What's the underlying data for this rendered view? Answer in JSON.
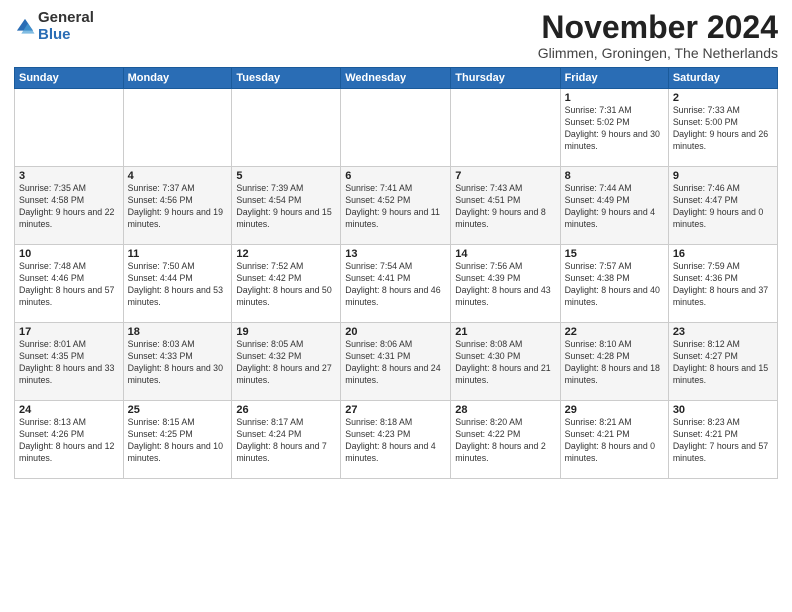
{
  "logo": {
    "general": "General",
    "blue": "Blue"
  },
  "header": {
    "title": "November 2024",
    "location": "Glimmen, Groningen, The Netherlands"
  },
  "weekdays": [
    "Sunday",
    "Monday",
    "Tuesday",
    "Wednesday",
    "Thursday",
    "Friday",
    "Saturday"
  ],
  "weeks": [
    [
      {
        "day": "",
        "info": ""
      },
      {
        "day": "",
        "info": ""
      },
      {
        "day": "",
        "info": ""
      },
      {
        "day": "",
        "info": ""
      },
      {
        "day": "",
        "info": ""
      },
      {
        "day": "1",
        "info": "Sunrise: 7:31 AM\nSunset: 5:02 PM\nDaylight: 9 hours and 30 minutes."
      },
      {
        "day": "2",
        "info": "Sunrise: 7:33 AM\nSunset: 5:00 PM\nDaylight: 9 hours and 26 minutes."
      }
    ],
    [
      {
        "day": "3",
        "info": "Sunrise: 7:35 AM\nSunset: 4:58 PM\nDaylight: 9 hours and 22 minutes."
      },
      {
        "day": "4",
        "info": "Sunrise: 7:37 AM\nSunset: 4:56 PM\nDaylight: 9 hours and 19 minutes."
      },
      {
        "day": "5",
        "info": "Sunrise: 7:39 AM\nSunset: 4:54 PM\nDaylight: 9 hours and 15 minutes."
      },
      {
        "day": "6",
        "info": "Sunrise: 7:41 AM\nSunset: 4:52 PM\nDaylight: 9 hours and 11 minutes."
      },
      {
        "day": "7",
        "info": "Sunrise: 7:43 AM\nSunset: 4:51 PM\nDaylight: 9 hours and 8 minutes."
      },
      {
        "day": "8",
        "info": "Sunrise: 7:44 AM\nSunset: 4:49 PM\nDaylight: 9 hours and 4 minutes."
      },
      {
        "day": "9",
        "info": "Sunrise: 7:46 AM\nSunset: 4:47 PM\nDaylight: 9 hours and 0 minutes."
      }
    ],
    [
      {
        "day": "10",
        "info": "Sunrise: 7:48 AM\nSunset: 4:46 PM\nDaylight: 8 hours and 57 minutes."
      },
      {
        "day": "11",
        "info": "Sunrise: 7:50 AM\nSunset: 4:44 PM\nDaylight: 8 hours and 53 minutes."
      },
      {
        "day": "12",
        "info": "Sunrise: 7:52 AM\nSunset: 4:42 PM\nDaylight: 8 hours and 50 minutes."
      },
      {
        "day": "13",
        "info": "Sunrise: 7:54 AM\nSunset: 4:41 PM\nDaylight: 8 hours and 46 minutes."
      },
      {
        "day": "14",
        "info": "Sunrise: 7:56 AM\nSunset: 4:39 PM\nDaylight: 8 hours and 43 minutes."
      },
      {
        "day": "15",
        "info": "Sunrise: 7:57 AM\nSunset: 4:38 PM\nDaylight: 8 hours and 40 minutes."
      },
      {
        "day": "16",
        "info": "Sunrise: 7:59 AM\nSunset: 4:36 PM\nDaylight: 8 hours and 37 minutes."
      }
    ],
    [
      {
        "day": "17",
        "info": "Sunrise: 8:01 AM\nSunset: 4:35 PM\nDaylight: 8 hours and 33 minutes."
      },
      {
        "day": "18",
        "info": "Sunrise: 8:03 AM\nSunset: 4:33 PM\nDaylight: 8 hours and 30 minutes."
      },
      {
        "day": "19",
        "info": "Sunrise: 8:05 AM\nSunset: 4:32 PM\nDaylight: 8 hours and 27 minutes."
      },
      {
        "day": "20",
        "info": "Sunrise: 8:06 AM\nSunset: 4:31 PM\nDaylight: 8 hours and 24 minutes."
      },
      {
        "day": "21",
        "info": "Sunrise: 8:08 AM\nSunset: 4:30 PM\nDaylight: 8 hours and 21 minutes."
      },
      {
        "day": "22",
        "info": "Sunrise: 8:10 AM\nSunset: 4:28 PM\nDaylight: 8 hours and 18 minutes."
      },
      {
        "day": "23",
        "info": "Sunrise: 8:12 AM\nSunset: 4:27 PM\nDaylight: 8 hours and 15 minutes."
      }
    ],
    [
      {
        "day": "24",
        "info": "Sunrise: 8:13 AM\nSunset: 4:26 PM\nDaylight: 8 hours and 12 minutes."
      },
      {
        "day": "25",
        "info": "Sunrise: 8:15 AM\nSunset: 4:25 PM\nDaylight: 8 hours and 10 minutes."
      },
      {
        "day": "26",
        "info": "Sunrise: 8:17 AM\nSunset: 4:24 PM\nDaylight: 8 hours and 7 minutes."
      },
      {
        "day": "27",
        "info": "Sunrise: 8:18 AM\nSunset: 4:23 PM\nDaylight: 8 hours and 4 minutes."
      },
      {
        "day": "28",
        "info": "Sunrise: 8:20 AM\nSunset: 4:22 PM\nDaylight: 8 hours and 2 minutes."
      },
      {
        "day": "29",
        "info": "Sunrise: 8:21 AM\nSunset: 4:21 PM\nDaylight: 8 hours and 0 minutes."
      },
      {
        "day": "30",
        "info": "Sunrise: 8:23 AM\nSunset: 4:21 PM\nDaylight: 7 hours and 57 minutes."
      }
    ]
  ]
}
